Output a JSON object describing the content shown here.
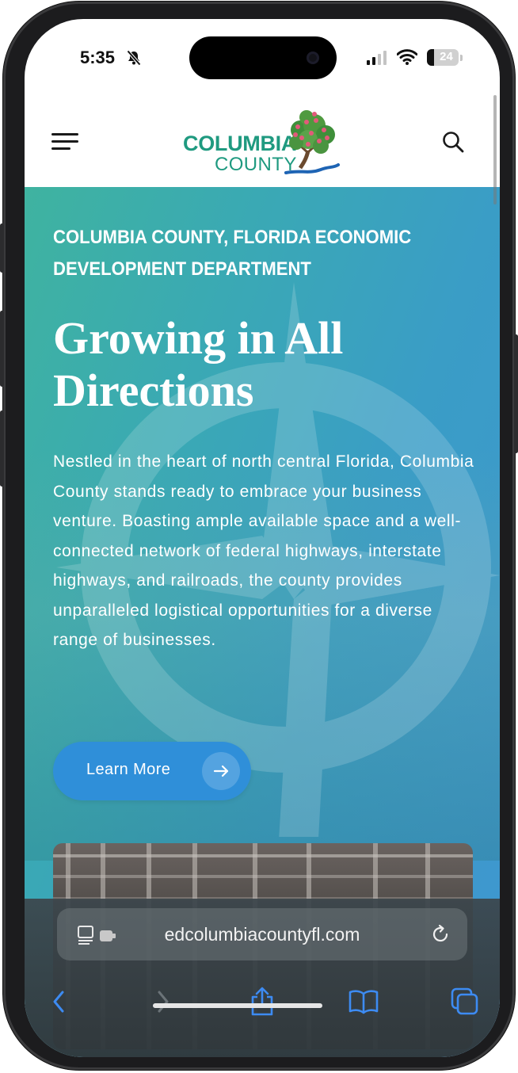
{
  "status_bar": {
    "time": "5:35",
    "battery_level": "24",
    "icons": [
      "bell-slash-icon",
      "cellular-signal-icon",
      "wifi-icon",
      "battery-icon"
    ]
  },
  "header": {
    "logo": {
      "line1": "COLUMBIA",
      "line2": "COUNTY"
    },
    "menu_icon": "hamburger-menu-icon",
    "search_icon": "search-icon"
  },
  "hero": {
    "eyebrow": "COLUMBIA COUNTY, FLORIDA ECONOMIC DEVELOPMENT DEPARTMENT",
    "title": "Growing in All Directions",
    "description": "Nestled in the heart of north central Florida, Columbia County stands ready to embrace your business venture. Boasting ample available space and a well-connected network of federal highways, interstate highways, and railroads, the county provides unparalleled logistical opportunities for a diverse range of businesses.",
    "cta_label": "Learn More",
    "cta_icon": "arrow-right-icon"
  },
  "browser": {
    "url": "edcolumbiacountyfl.com",
    "icons": [
      "page-menu-icon",
      "reload-icon",
      "back-icon",
      "forward-icon",
      "share-icon",
      "bookmarks-icon",
      "tabs-icon"
    ]
  },
  "colors": {
    "brand_teal": "#1f9a80",
    "hero_gradient_start": "#3fb3a0",
    "hero_gradient_end": "#3f96d0",
    "cta_blue": "#2f8fd9",
    "safari_accent": "#3d8bf2"
  }
}
